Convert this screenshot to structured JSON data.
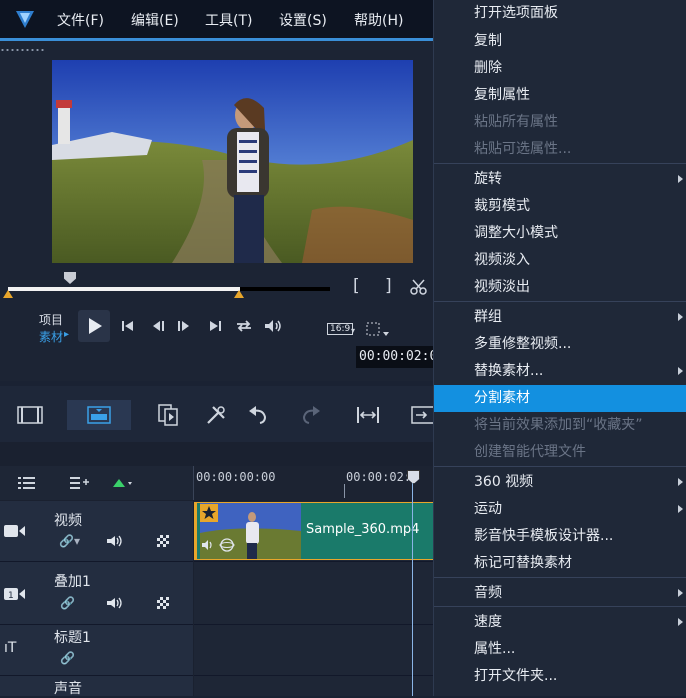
{
  "menubar": {
    "items": [
      "文件(F)",
      "编辑(E)",
      "工具(T)",
      "设置(S)",
      "帮助(H)"
    ]
  },
  "player": {
    "mode_project": "项目",
    "mode_clip": "素材",
    "aspect": "16:9",
    "timecode": "00:00:02:0",
    "scrub_progress": 0.72
  },
  "timeline": {
    "ruler": [
      "00:00:00:00",
      "00:00:02:0"
    ],
    "tracks": [
      {
        "name": "视频"
      },
      {
        "name": "叠加1"
      },
      {
        "name": "标题1"
      },
      {
        "name": "声音"
      }
    ],
    "clip_name": "Sample_360.mp4"
  },
  "context_menu": {
    "items": [
      {
        "label": "打开选项面板",
        "state": "normal",
        "submenu": false
      },
      {
        "label": "复制",
        "state": "normal",
        "submenu": false
      },
      {
        "label": "删除",
        "state": "normal",
        "submenu": false
      },
      {
        "label": "复制属性",
        "state": "normal",
        "submenu": false
      },
      {
        "label": "粘贴所有属性",
        "state": "disabled",
        "submenu": false
      },
      {
        "label": "粘贴可选属性...",
        "state": "disabled",
        "submenu": false
      },
      {
        "label": "旋转",
        "state": "normal",
        "submenu": true
      },
      {
        "label": "裁剪模式",
        "state": "normal",
        "submenu": false
      },
      {
        "label": "调整大小模式",
        "state": "normal",
        "submenu": false
      },
      {
        "label": "视频淡入",
        "state": "normal",
        "submenu": false
      },
      {
        "label": "视频淡出",
        "state": "normal",
        "submenu": false
      },
      {
        "label": "群组",
        "state": "normal",
        "submenu": true
      },
      {
        "label": "多重修整视频...",
        "state": "normal",
        "submenu": false
      },
      {
        "label": "替换素材...",
        "state": "normal",
        "submenu": true
      },
      {
        "label": "分割素材",
        "state": "active",
        "submenu": false
      },
      {
        "label": "将当前效果添加到“收藏夹”",
        "state": "disabled",
        "submenu": false
      },
      {
        "label": "创建智能代理文件",
        "state": "disabled",
        "submenu": false
      },
      {
        "label": "360 视频",
        "state": "normal",
        "submenu": true
      },
      {
        "label": "运动",
        "state": "normal",
        "submenu": true
      },
      {
        "label": "影音快手模板设计器...",
        "state": "normal",
        "submenu": false
      },
      {
        "label": "标记可替换素材",
        "state": "normal",
        "submenu": false
      },
      {
        "label": "音频",
        "state": "normal",
        "submenu": true
      },
      {
        "label": "速度",
        "state": "normal",
        "submenu": true
      },
      {
        "label": "属性...",
        "state": "normal",
        "submenu": false
      },
      {
        "label": "打开文件夹...",
        "state": "normal",
        "submenu": false
      }
    ]
  },
  "colors": {
    "accent": "#1390e0",
    "clip": "#1a7a6a",
    "trim": "#e8a62b"
  }
}
